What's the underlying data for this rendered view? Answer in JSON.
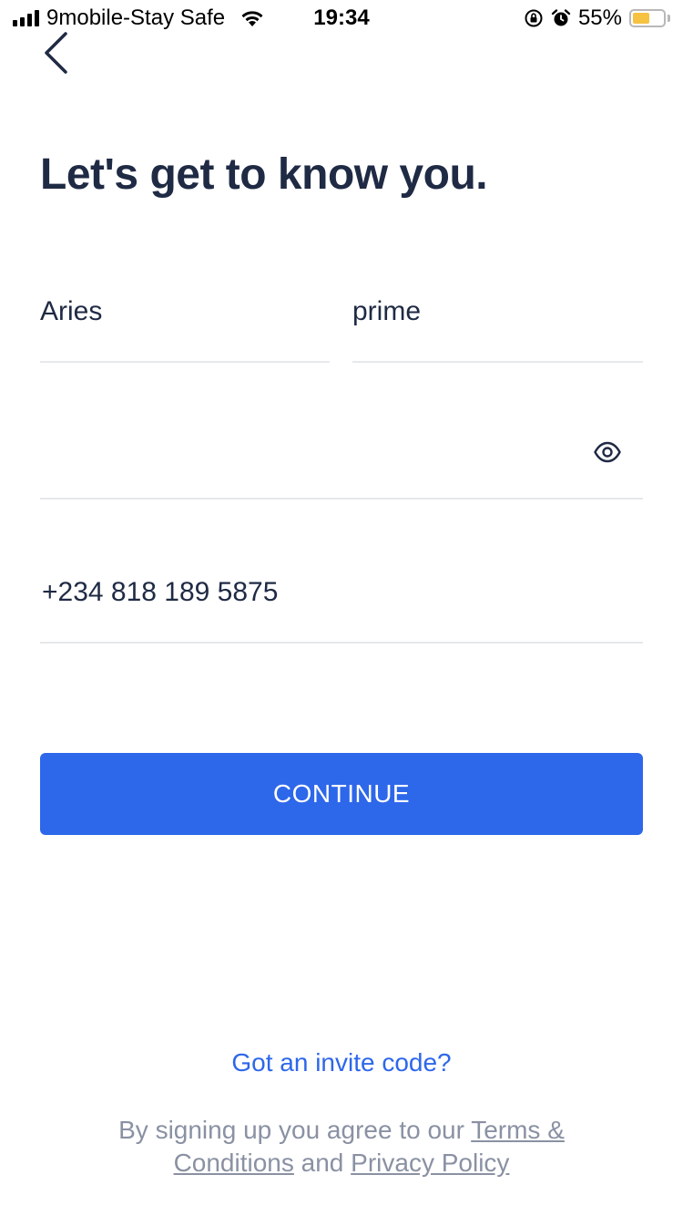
{
  "status_bar": {
    "carrier": "9mobile-Stay Safe",
    "time": "19:34",
    "battery_percent": "55%",
    "battery_level": 0.55,
    "battery_color": "#f5c242"
  },
  "header": {
    "back_icon": "chevron-left-icon",
    "title": "Let's get to know you."
  },
  "form": {
    "first_name": "Aries",
    "last_name": "prime",
    "password": "",
    "password_toggle_icon": "eye-icon",
    "phone": "+234 818 189 5875"
  },
  "actions": {
    "continue_label": "CONTINUE",
    "continue_color": "#2d67ea",
    "invite_label": "Got an invite code?"
  },
  "legal": {
    "prefix": "By signing up you agree to our ",
    "terms_label": "Terms & Conditions",
    "middle": " and ",
    "privacy_label": "Privacy Policy"
  }
}
